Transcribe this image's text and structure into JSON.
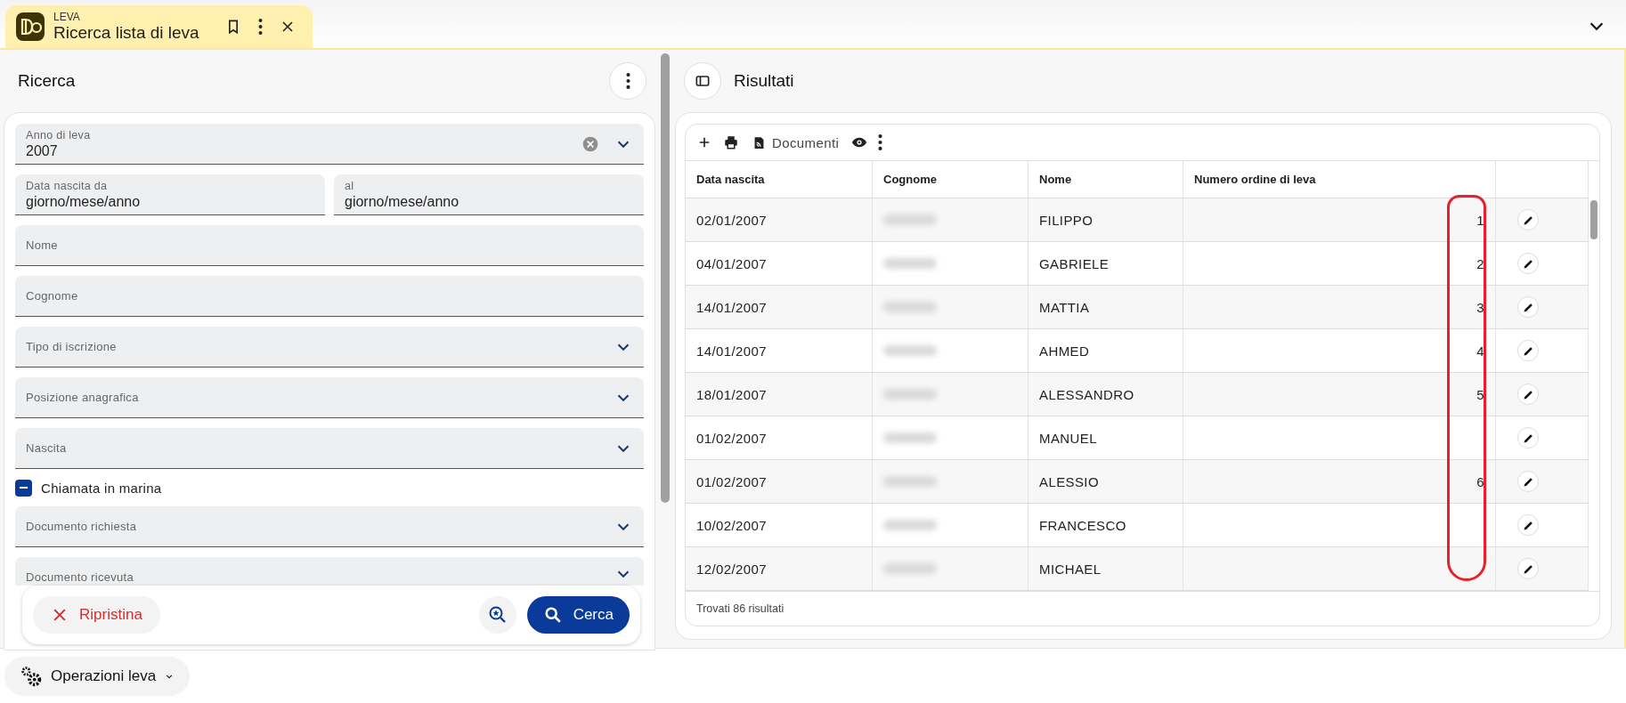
{
  "tab": {
    "app": "LEVA",
    "title": "Ricerca lista di leva",
    "selected": true
  },
  "search_panel": {
    "title": "Ricerca",
    "fields": [
      {
        "kind": "select",
        "label": "Anno di leva",
        "value": "2007",
        "clearable": true
      },
      {
        "kind": "date-pair",
        "items": [
          {
            "label": "Data nascita da",
            "placeholder": "giorno/mese/anno"
          },
          {
            "label": "al",
            "placeholder": "giorno/mese/anno"
          }
        ]
      },
      {
        "kind": "text",
        "label": "Nome"
      },
      {
        "kind": "text",
        "label": "Cognome"
      },
      {
        "kind": "select",
        "label": "Tipo di iscrizione"
      },
      {
        "kind": "select",
        "label": "Posizione anagrafica"
      },
      {
        "kind": "select",
        "label": "Nascita"
      },
      {
        "kind": "checkbox",
        "label": "Chiamata in marina",
        "indeterminate": true
      },
      {
        "kind": "select",
        "label": "Documento richiesta"
      },
      {
        "kind": "select",
        "label": "Documento ricevuta"
      }
    ],
    "reset_button": "Ripristina",
    "search_button": "Cerca"
  },
  "results_panel": {
    "title": "Risultati",
    "toolbar_documents": "Documenti",
    "columns": [
      "Data nascita",
      "Cognome",
      "Nome",
      "Numero ordine di leva"
    ],
    "rows": [
      {
        "birth_date": "02/01/2007",
        "first_name": "FILIPPO",
        "number": "1"
      },
      {
        "birth_date": "04/01/2007",
        "first_name": "GABRIELE",
        "number": "2"
      },
      {
        "birth_date": "14/01/2007",
        "first_name": "MATTIA",
        "number": "3"
      },
      {
        "birth_date": "14/01/2007",
        "first_name": "AHMED",
        "number": "4"
      },
      {
        "birth_date": "18/01/2007",
        "first_name": "ALESSANDRO",
        "number": "5"
      },
      {
        "birth_date": "01/02/2007",
        "first_name": "MANUEL"
      },
      {
        "birth_date": "01/02/2007",
        "first_name": "ALESSIO",
        "number": "6"
      },
      {
        "birth_date": "10/02/2007",
        "first_name": "FRANCESCO"
      },
      {
        "birth_date": "12/02/2007",
        "first_name": "MICHAEL"
      }
    ],
    "footer": "Trovati 86 risultati"
  },
  "bottom_bar": {
    "operations_button": "Operazioni leva"
  }
}
